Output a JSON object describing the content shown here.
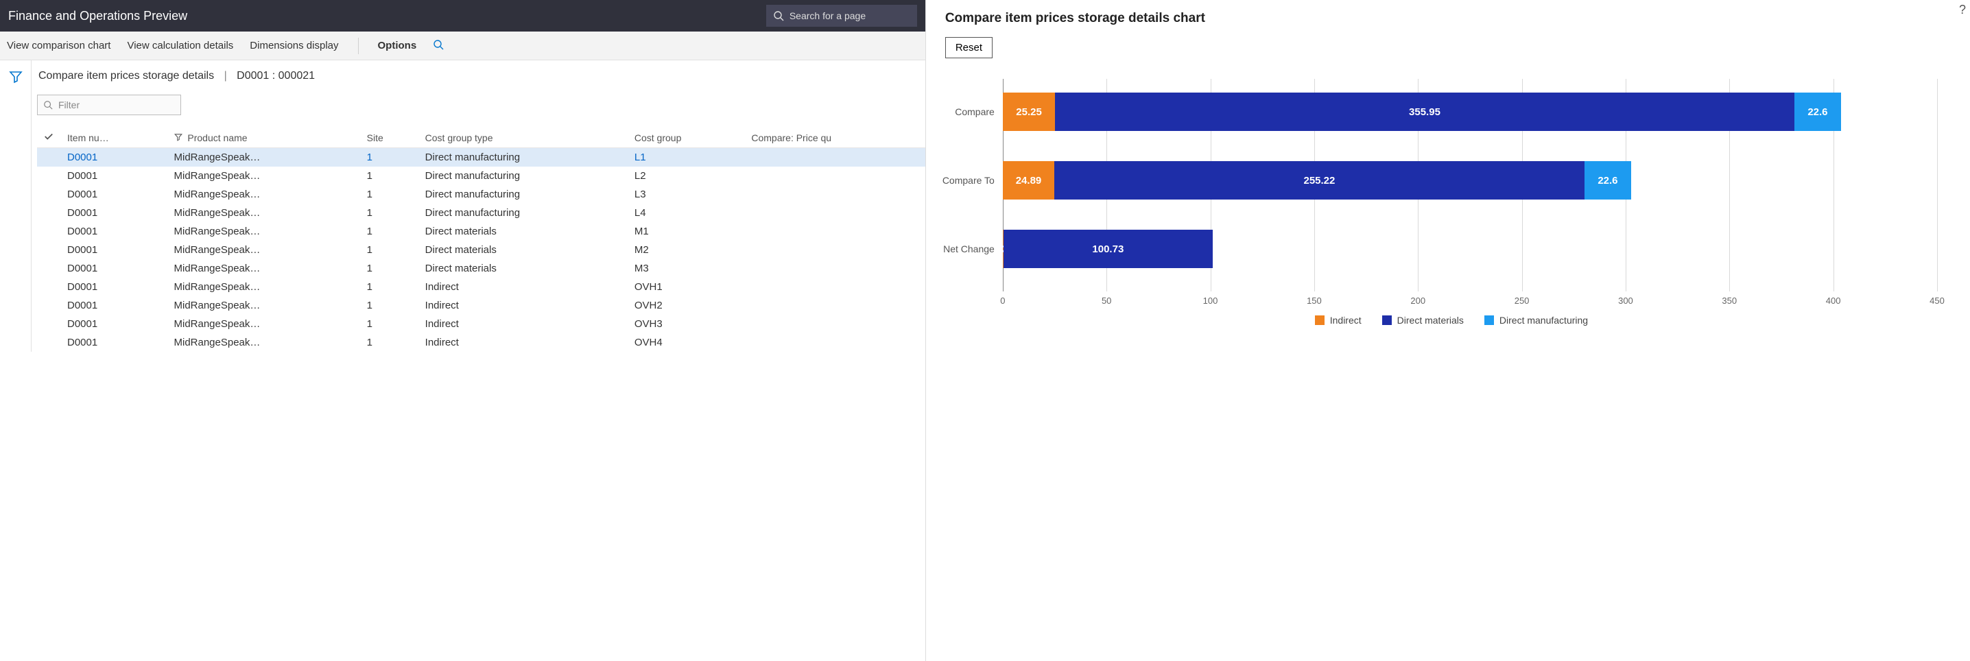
{
  "app": {
    "title": "Finance and Operations Preview",
    "search_placeholder": "Search for a page"
  },
  "cmdbar": {
    "view_chart": "View comparison chart",
    "view_calc": "View calculation details",
    "dimensions": "Dimensions display",
    "options": "Options"
  },
  "breadcrumb": {
    "page": "Compare item prices storage details",
    "sep": "|",
    "context": "D0001 : 000021"
  },
  "filter_placeholder": "Filter",
  "grid": {
    "headers": {
      "item": "Item nu…",
      "product": "Product name",
      "site": "Site",
      "costgrouptype": "Cost group type",
      "costgroup": "Cost group",
      "compare": "Compare: Price qu"
    },
    "rows": [
      {
        "item": "D0001",
        "product": "MidRangeSpeak…",
        "site": "1",
        "cgt": "Direct manufacturing",
        "cg": "L1",
        "sel": true
      },
      {
        "item": "D0001",
        "product": "MidRangeSpeak…",
        "site": "1",
        "cgt": "Direct manufacturing",
        "cg": "L2"
      },
      {
        "item": "D0001",
        "product": "MidRangeSpeak…",
        "site": "1",
        "cgt": "Direct manufacturing",
        "cg": "L3"
      },
      {
        "item": "D0001",
        "product": "MidRangeSpeak…",
        "site": "1",
        "cgt": "Direct manufacturing",
        "cg": "L4"
      },
      {
        "item": "D0001",
        "product": "MidRangeSpeak…",
        "site": "1",
        "cgt": "Direct materials",
        "cg": "M1"
      },
      {
        "item": "D0001",
        "product": "MidRangeSpeak…",
        "site": "1",
        "cgt": "Direct materials",
        "cg": "M2"
      },
      {
        "item": "D0001",
        "product": "MidRangeSpeak…",
        "site": "1",
        "cgt": "Direct materials",
        "cg": "M3"
      },
      {
        "item": "D0001",
        "product": "MidRangeSpeak…",
        "site": "1",
        "cgt": "Indirect",
        "cg": "OVH1"
      },
      {
        "item": "D0001",
        "product": "MidRangeSpeak…",
        "site": "1",
        "cgt": "Indirect",
        "cg": "OVH2"
      },
      {
        "item": "D0001",
        "product": "MidRangeSpeak…",
        "site": "1",
        "cgt": "Indirect",
        "cg": "OVH3"
      },
      {
        "item": "D0001",
        "product": "MidRangeSpeak…",
        "site": "1",
        "cgt": "Indirect",
        "cg": "OVH4"
      }
    ]
  },
  "chart_panel": {
    "title": "Compare item prices storage details chart",
    "reset": "Reset",
    "legend": {
      "indirect": "Indirect",
      "materials": "Direct materials",
      "manufacturing": "Direct manufacturing"
    }
  },
  "chart_data": {
    "type": "bar",
    "orientation": "horizontal",
    "stacked": true,
    "categories": [
      "Compare",
      "Compare To",
      "Net Change"
    ],
    "series": [
      {
        "name": "Indirect",
        "key": "indirect",
        "values": [
          25.25,
          24.89,
          0.36
        ]
      },
      {
        "name": "Direct materials",
        "key": "materials",
        "values": [
          355.95,
          255.22,
          100.73
        ]
      },
      {
        "name": "Direct manufacturing",
        "key": "manufacturing",
        "values": [
          22.6,
          22.6,
          0.0
        ]
      }
    ],
    "xlabel": "",
    "ylabel": "",
    "xlim": [
      0,
      450
    ],
    "ticks": [
      0,
      50,
      100,
      150,
      200,
      250,
      300,
      350,
      400,
      450
    ],
    "title": "Compare item prices storage details chart"
  }
}
